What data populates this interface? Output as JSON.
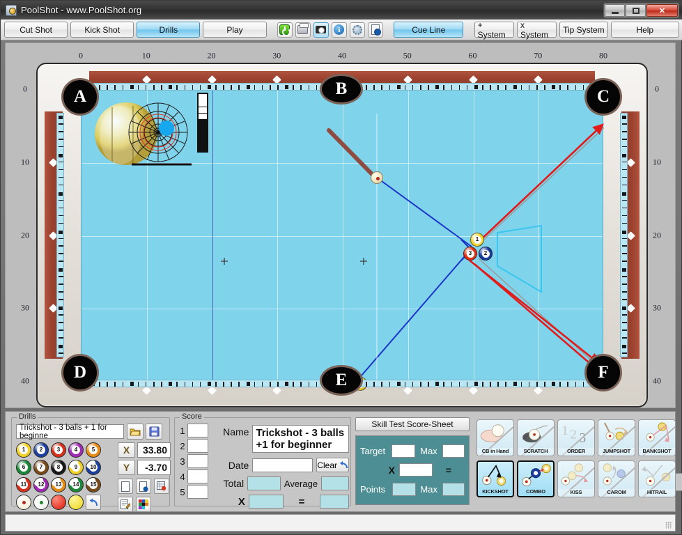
{
  "window": {
    "title": "PoolShot - www.PoolShot.org",
    "icon": "poolshot-app-icon",
    "minimize": "–",
    "maximize": "□",
    "close": "✕"
  },
  "toolbar": {
    "buttons": [
      {
        "label": "Cut Shot",
        "active": false
      },
      {
        "label": "Kick Shot",
        "active": false
      },
      {
        "label": "Drills",
        "active": true
      },
      {
        "label": "Play",
        "active": false
      }
    ],
    "icons": [
      {
        "name": "power-icon",
        "selected": false
      },
      {
        "name": "print-icon",
        "selected": false
      },
      {
        "name": "camera-icon",
        "selected": true
      },
      {
        "name": "info-icon",
        "selected": false,
        "glyph": "i"
      },
      {
        "name": "settings-gear-icon",
        "selected": false
      },
      {
        "name": "document-help-icon",
        "selected": false
      }
    ],
    "cue_line": {
      "label": "Cue Line",
      "active": true
    },
    "plus_system": "+ System",
    "x_system": "x System",
    "tip_system": "Tip System",
    "help": "Help"
  },
  "table": {
    "top_ruler": [
      "0",
      "10",
      "20",
      "30",
      "40",
      "50",
      "60",
      "70",
      "80"
    ],
    "left_ruler": [
      "0",
      "10",
      "20",
      "30",
      "40"
    ],
    "right_ruler": [
      "0",
      "10",
      "20",
      "30",
      "40"
    ],
    "pockets": [
      {
        "label": "A",
        "position": "top-left"
      },
      {
        "label": "B",
        "position": "top-center"
      },
      {
        "label": "C",
        "position": "top-right"
      },
      {
        "label": "D",
        "position": "bottom-left"
      },
      {
        "label": "E",
        "position": "bottom-center"
      },
      {
        "label": "F",
        "position": "bottom-right"
      }
    ],
    "balls": [
      {
        "number": "1",
        "color": "#f5d73a",
        "type": "solid"
      },
      {
        "number": "2",
        "color": "#1b3fa0",
        "type": "solid"
      },
      {
        "number": "3",
        "color": "#e03118",
        "type": "solid"
      },
      {
        "number": "9",
        "color": "#f5d73a",
        "type": "stripe"
      }
    ],
    "cue_ball": "cue-ball",
    "felt_color": "#7fd3ea",
    "rail_color": "#9c422f"
  },
  "drills": {
    "legend": "Drills",
    "selected_drill": "Trickshot - 3 balls + 1 for beginne",
    "open_icon": "folder-open-icon",
    "save_icon": "floppy-save-icon",
    "x_label": "X",
    "x_value": "33.80",
    "y_label": "Y",
    "y_value": "-3.70",
    "ball_buttons": [
      "1",
      "2",
      "3",
      "4",
      "5",
      "6",
      "7",
      "8",
      "9",
      "10",
      "11",
      "12",
      "13",
      "14",
      "15"
    ],
    "extra_buttons": [
      {
        "name": "cue-ball-red-dot-button"
      },
      {
        "name": "cue-ball-green-dot-button"
      },
      {
        "name": "red-ball-button"
      },
      {
        "name": "yellow-ball-button"
      },
      {
        "name": "undo-arrow-button"
      }
    ],
    "tool_buttons": [
      {
        "name": "new-document-button"
      },
      {
        "name": "document-help-button"
      },
      {
        "name": "table-report-button"
      },
      {
        "name": "edit-notes-button"
      },
      {
        "name": "color-palette-button"
      }
    ]
  },
  "score": {
    "legend": "Score",
    "rows": [
      "1",
      "2",
      "3",
      "4",
      "5"
    ],
    "row_values": [
      "",
      "",
      "",
      "",
      ""
    ],
    "name_label": "Name",
    "name_value": "Trickshot - 3 balls +1 for beginner",
    "date_label": "Date",
    "date_value": "",
    "clear_label": "Clear",
    "clear_icon": "undo-arrow-icon",
    "total_label": "Total",
    "total_value": "",
    "average_label": "Average",
    "average_value": "",
    "multiply_label": "X",
    "multiply_value": "",
    "equals_label": "=",
    "equals_value": ""
  },
  "skill_sheet": {
    "title": "Skill Test Score-Sheet",
    "target_label": "Target",
    "target_value": "",
    "target_max_label": "Max",
    "target_max_value": "",
    "times_label": "X",
    "times_value": "",
    "equals_label": "=",
    "points_label": "Points",
    "points_value": "",
    "points_max_label": "Max",
    "points_max_value": ""
  },
  "options": {
    "row1": [
      {
        "label": "CB in Hand",
        "icon": "cb-in-hand-icon",
        "on": false
      },
      {
        "label": "SCRATCH",
        "icon": "scratch-icon",
        "on": false
      },
      {
        "label": "ORDER",
        "icon": "order-123-icon",
        "on": false
      },
      {
        "label": "JUMPSHOT",
        "icon": "jumpshot-icon",
        "on": false
      },
      {
        "label": "BANKSHOT",
        "icon": "bankshot-icon",
        "on": false
      }
    ],
    "row2": [
      {
        "label": "KICKSHOT",
        "icon": "kickshot-icon",
        "on": true
      },
      {
        "label": "COMBO",
        "icon": "combo-icon",
        "on": true
      },
      {
        "label": "KISS",
        "icon": "kiss-icon",
        "on": false
      },
      {
        "label": "CAROM",
        "icon": "carom-icon",
        "on": false
      },
      {
        "label": "HITRAIL",
        "icon": "hitrail-icon",
        "on": false
      }
    ]
  },
  "colors": {
    "accent": "#70c4ec",
    "felt": "#7fd3ea",
    "rail": "#9c422f",
    "sheet_bg": "#4d8e94",
    "cyan_field": "#b4e1e8",
    "aim_line_blue": "#1a35c8",
    "aim_line_red": "#e11b1b"
  }
}
